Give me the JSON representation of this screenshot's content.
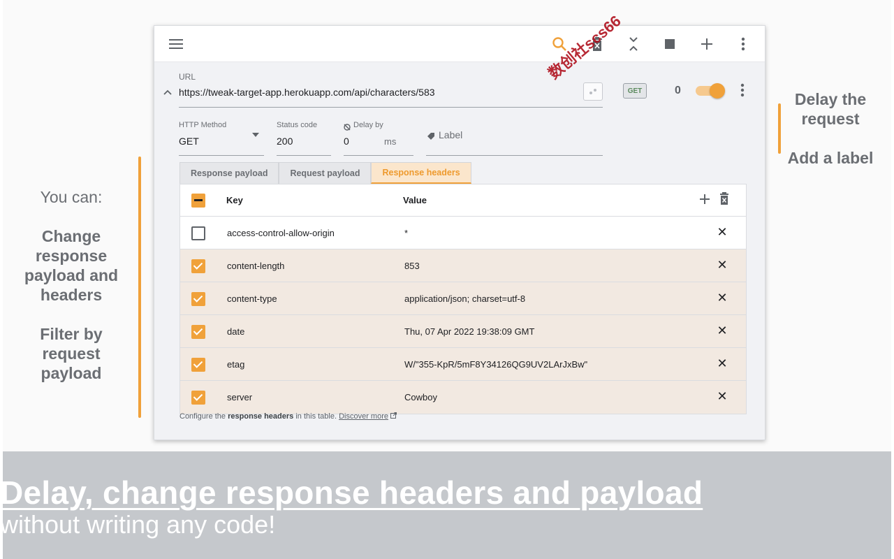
{
  "colors": {
    "accent": "#f0a13a",
    "banner_bg": "#c5c8cc",
    "checked_row": "#f2e9e1"
  },
  "annotations": {
    "left": {
      "intro": "You can:",
      "item1": "Change response payload and headers",
      "item2": "Filter by request payload"
    },
    "right": {
      "item1": "Delay the request",
      "item2": "Add a label"
    }
  },
  "toolbar": {
    "icons": [
      "menu-icon",
      "search-icon",
      "delete-all-icon",
      "collapse-all-icon",
      "stop-icon",
      "add-icon",
      "more-vert-icon"
    ]
  },
  "request": {
    "url_label": "URL",
    "url": "https://tweak-target-app.herokuapp.com/api/characters/583",
    "method_badge": "GET",
    "count": "0",
    "enabled": true,
    "http_method_label": "HTTP Method",
    "http_method": "GET",
    "status_label": "Status code",
    "status": "200",
    "delay_label": "Delay by",
    "delay": "0",
    "delay_unit": "ms",
    "label_placeholder": "Label"
  },
  "tabs": [
    {
      "label": "Response payload",
      "active": false
    },
    {
      "label": "Request payload",
      "active": false
    },
    {
      "label": "Response headers",
      "active": true
    }
  ],
  "table": {
    "key_header": "Key",
    "value_header": "Value",
    "rows": [
      {
        "key": "access-control-allow-origin",
        "value": "*",
        "checked": false
      },
      {
        "key": "content-length",
        "value": "853",
        "checked": true
      },
      {
        "key": "content-type",
        "value": "application/json; charset=utf-8",
        "checked": true
      },
      {
        "key": "date",
        "value": "Thu, 07 Apr 2022 19:38:09 GMT",
        "checked": true
      },
      {
        "key": "etag",
        "value": "W/\"355-KpR/5mF8Y34126QG9UV2LArJxBw\"",
        "checked": true
      },
      {
        "key": "server",
        "value": "Cowboy",
        "checked": true
      }
    ]
  },
  "footnote": {
    "prefix": "Configure the",
    "bold": "response headers",
    "suffix": "in this table.",
    "link": "Discover more"
  },
  "banner": {
    "title": "Delay, change response headers and payload",
    "subtitle": "without writing any code!"
  },
  "watermark": "数创社scs66"
}
